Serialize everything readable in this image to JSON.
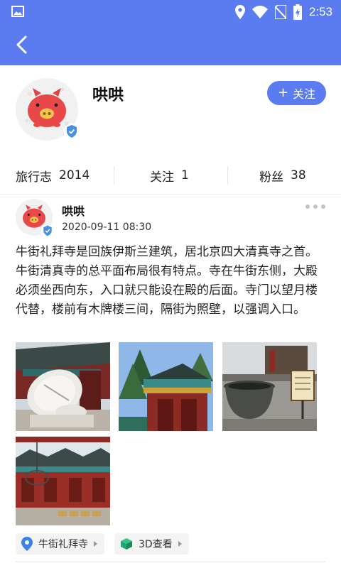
{
  "status_bar": {
    "time": "2:53"
  },
  "profile": {
    "name": "哄哄",
    "follow_label": "关注",
    "follow_plus": "+"
  },
  "stats": [
    {
      "label": "旅行志",
      "value": "2014"
    },
    {
      "label": "关注",
      "value": "1"
    },
    {
      "label": "粉丝",
      "value": "38"
    }
  ],
  "post": {
    "author": "哄哄",
    "time": "2020-09-11 08:30",
    "text": "牛街礼拜寺是回族伊斯兰建筑，居北京四大清真寺之首。牛街清真寺的总平面布局很有特点。寺在牛街东侧，大殿必须坐西向东，入口就只能设在殿的后面。寺门以望月楼代替，楼前有木牌楼三间，隔街为照壁，以强调入口。",
    "tags": [
      {
        "label": "牛街礼拜寺",
        "icon": "location-pin-icon"
      },
      {
        "label": "3D查看",
        "icon": "cube-3d-icon"
      }
    ]
  },
  "colors": {
    "primary": "#5b7cf0",
    "verified": "#4a90e2",
    "tag_bg": "#f3f3f3"
  }
}
